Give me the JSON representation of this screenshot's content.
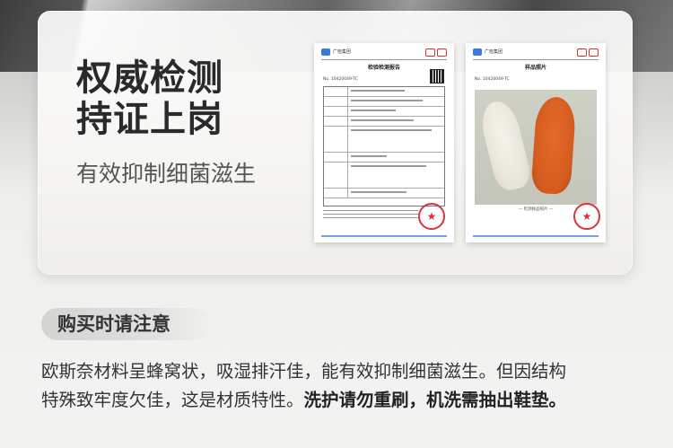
{
  "headline": {
    "line1": "权威检测",
    "line2": "持证上岗"
  },
  "subhead": "有效抑制细菌滋生",
  "documents": {
    "report": {
      "org": "广检集团",
      "title": "检验检测报告",
      "report_no": "No. 10420049-TC"
    },
    "sample_photo": {
      "org": "广检集团",
      "title": "样品照片",
      "report_no": "No. 10420049-TC",
      "caption": "— 检测样品照片 —"
    }
  },
  "notice": {
    "label": "购买时请注意",
    "line1": "欧斯奈材料呈蜂窝状，吸湿排汗佳，能有效抑制细菌滋生。但因结构",
    "line2_normal": "特殊致牢度欠佳，这是材质特性。",
    "line2_bold": "洗护请勿重刷，机洗需抽出鞋垫。"
  },
  "colors": {
    "headline": "#2a2a2a",
    "stamp": "#d9333f",
    "insole_orange": "#d35c1e",
    "insole_white": "#efece2"
  }
}
